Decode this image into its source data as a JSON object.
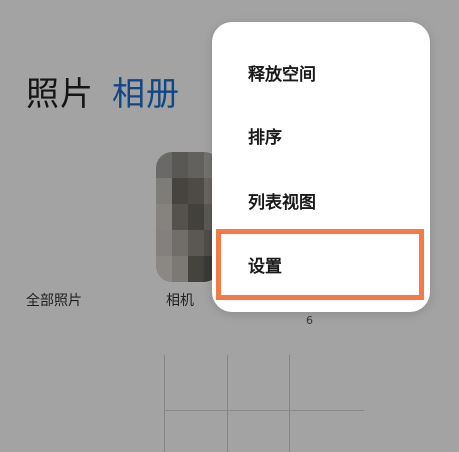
{
  "tabs": [
    {
      "label": "照片",
      "active": false
    },
    {
      "label": "相册",
      "active": true
    }
  ],
  "albums": [
    {
      "label": "全部照片"
    },
    {
      "label": "相机"
    }
  ],
  "album_count": "6",
  "menu": {
    "items": [
      {
        "label": "释放空间"
      },
      {
        "label": "排序"
      },
      {
        "label": "列表视图"
      },
      {
        "label": "设置",
        "highlighted": true
      }
    ]
  },
  "colors": {
    "accent": "#1d6fd1",
    "highlight": "#f47a46"
  }
}
